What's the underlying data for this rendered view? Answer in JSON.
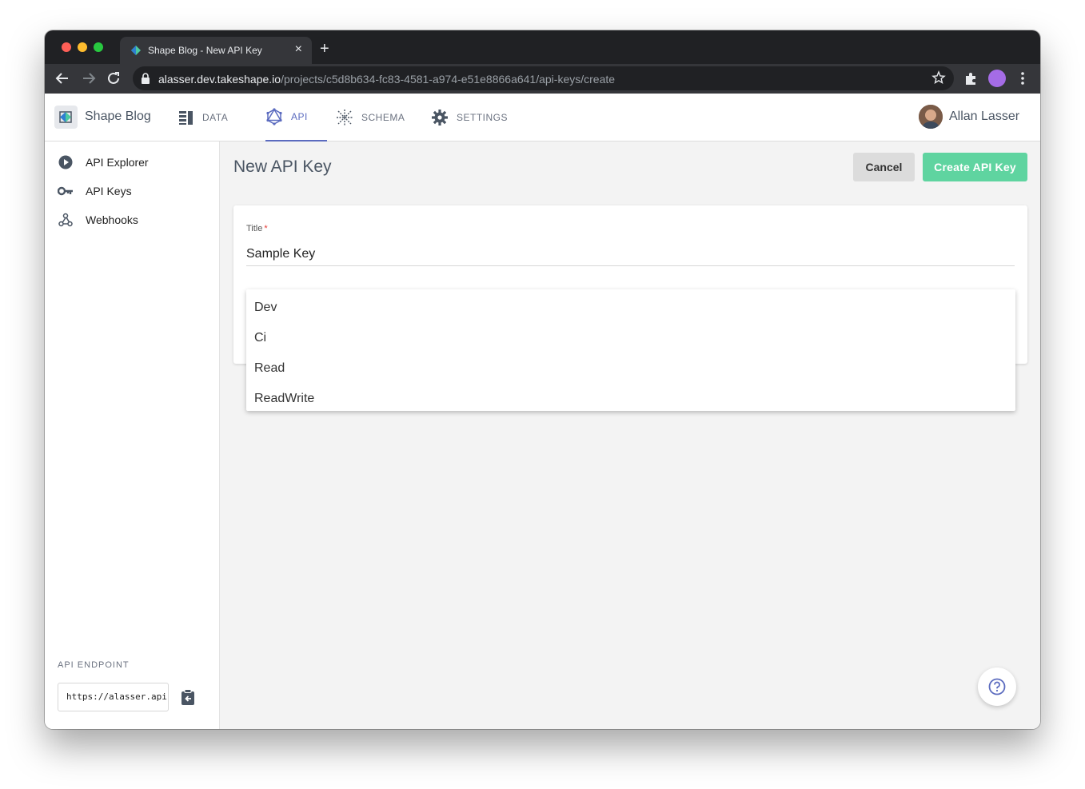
{
  "browser": {
    "tab_title": "Shape Blog - New API Key",
    "url_host": "alasser.dev.takeshape.io",
    "url_path": "/projects/c5d8b634-fc83-4581-a974-e51e8866a641/api-keys/create"
  },
  "header": {
    "project_name": "Shape Blog",
    "nav": [
      {
        "label": "DATA"
      },
      {
        "label": "API"
      },
      {
        "label": "SCHEMA"
      },
      {
        "label": "SETTINGS"
      }
    ],
    "user_name": "Allan Lasser"
  },
  "sidebar": {
    "items": [
      {
        "label": "API Explorer",
        "icon": "play-circle-icon"
      },
      {
        "label": "API Keys",
        "icon": "key-icon"
      },
      {
        "label": "Webhooks",
        "icon": "webhook-icon"
      }
    ],
    "endpoint_label": "API ENDPOINT",
    "endpoint_value": "https://alasser.api"
  },
  "main": {
    "page_title": "New API Key",
    "cancel_label": "Cancel",
    "create_label": "Create API Key",
    "form": {
      "title_label": "Title",
      "required_mark": "*",
      "title_value": "Sample Key"
    },
    "dropdown_options": [
      "Dev",
      "Ci",
      "Read",
      "ReadWrite"
    ]
  },
  "colors": {
    "accent": "#5b6bbf",
    "create_button": "#5fd4a0",
    "chrome_dark": "#202124"
  }
}
